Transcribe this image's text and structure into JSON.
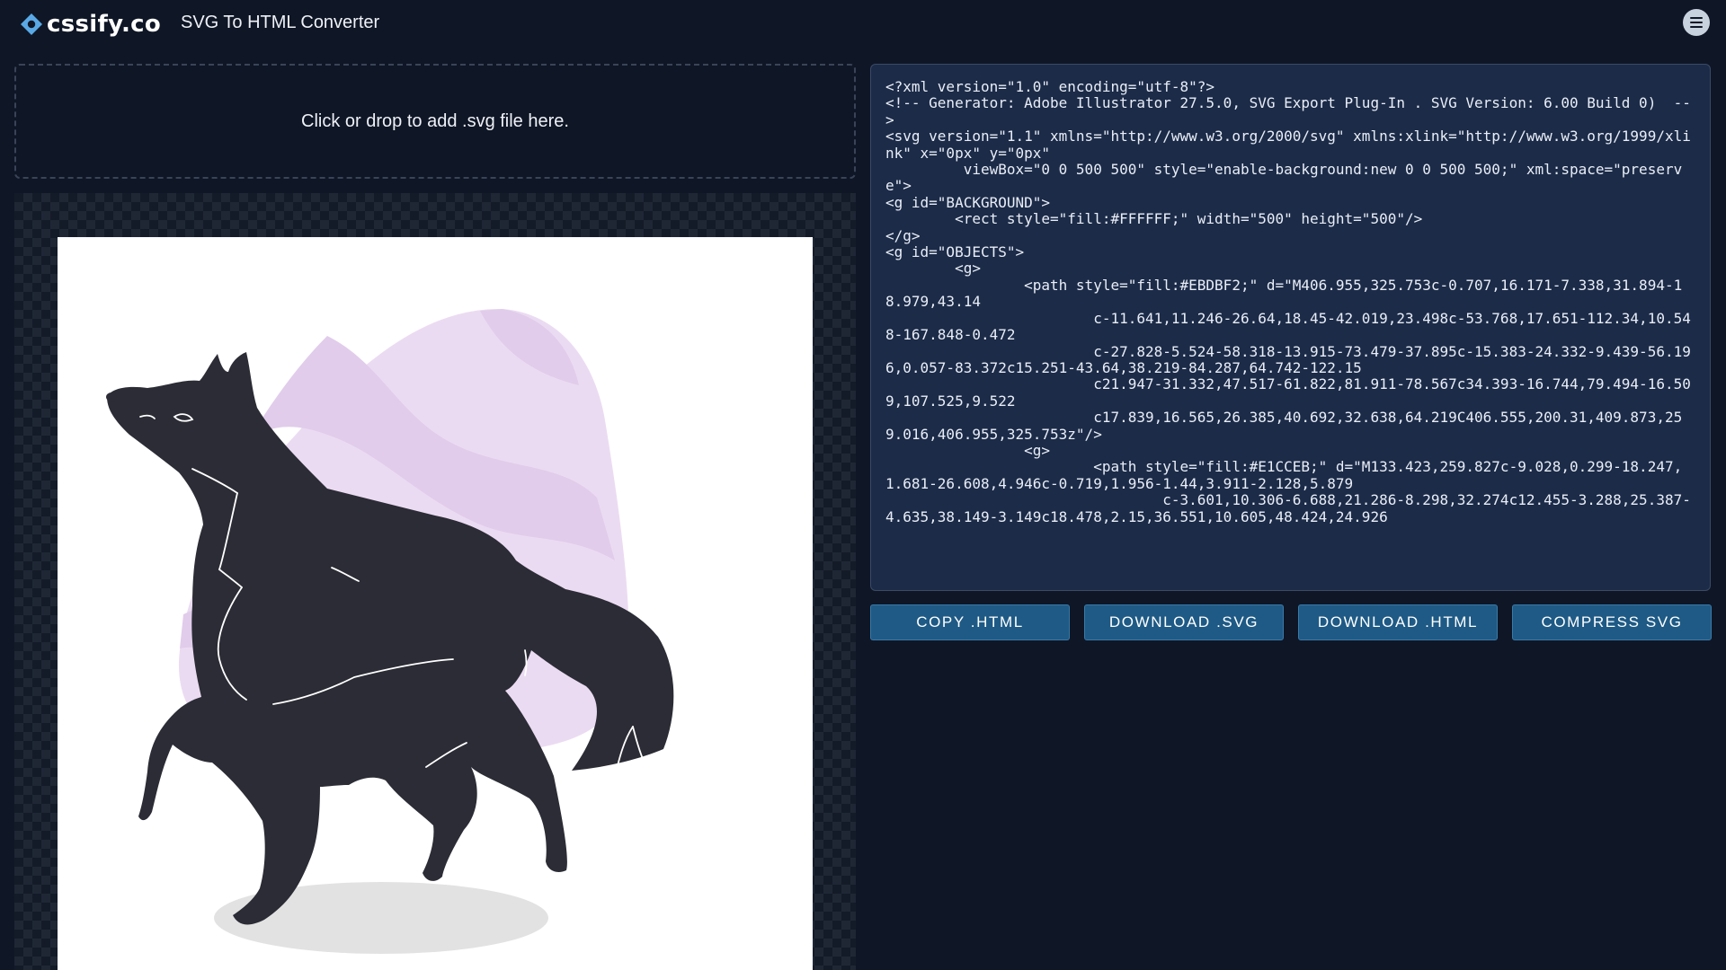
{
  "header": {
    "logo_text": "cssify.co",
    "title": "SVG To HTML Converter",
    "menu_icon": "hamburger-menu-icon"
  },
  "dropzone": {
    "text": "Click or drop to add .svg file here."
  },
  "code": {
    "value": "<?xml version=\"1.0\" encoding=\"utf-8\"?>\n<!-- Generator: Adobe Illustrator 27.5.0, SVG Export Plug-In . SVG Version: 6.00 Build 0)  -->\n<svg version=\"1.1\" xmlns=\"http://www.w3.org/2000/svg\" xmlns:xlink=\"http://www.w3.org/1999/xlink\" x=\"0px\" y=\"0px\"\n\t viewBox=\"0 0 500 500\" style=\"enable-background:new 0 0 500 500;\" xml:space=\"preserve\">\n<g id=\"BACKGROUND\">\n\t<rect style=\"fill:#FFFFFF;\" width=\"500\" height=\"500\"/>\n</g>\n<g id=\"OBJECTS\">\n\t<g>\n\t\t<path style=\"fill:#EBDBF2;\" d=\"M406.955,325.753c-0.707,16.171-7.338,31.894-18.979,43.14\n\t\t\tc-11.641,11.246-26.64,18.45-42.019,23.498c-53.768,17.651-112.34,10.548-167.848-0.472\n\t\t\tc-27.828-5.524-58.318-13.915-73.479-37.895c-15.383-24.332-9.439-56.196,0.057-83.372c15.251-43.64,38.219-84.287,64.742-122.15\n\t\t\tc21.947-31.332,47.517-61.822,81.911-78.567c34.393-16.744,79.494-16.509,107.525,9.522\n\t\t\tc17.839,16.565,26.385,40.692,32.638,64.219C406.555,200.31,409.873,259.016,406.955,325.753z\"/>\n\t\t<g>\n\t\t\t<path style=\"fill:#E1CCEB;\" d=\"M133.423,259.827c-9.028,0.299-18.247,1.681-26.608,4.946c-0.719,1.956-1.44,3.911-2.128,5.879\n\t\t\t\tc-3.601,10.306-6.688,21.286-8.298,32.274c12.455-3.288,25.387-4.635,38.149-3.149c18.478,2.15,36.551,10.605,48.424,24.926"
  },
  "buttons": {
    "copy_html": "COPY .HTML",
    "download_svg": "DOWNLOAD .SVG",
    "download_html": "DOWNLOAD .HTML",
    "compress_svg": "COMPRESS SVG"
  },
  "colors": {
    "page_background": "#0f1626",
    "code_background": "#1c2b48",
    "button_background": "#1e5a85",
    "blob_light": "#EBDBF2",
    "blob_mid": "#E1CCEB",
    "wolf": "#2b2c35"
  }
}
